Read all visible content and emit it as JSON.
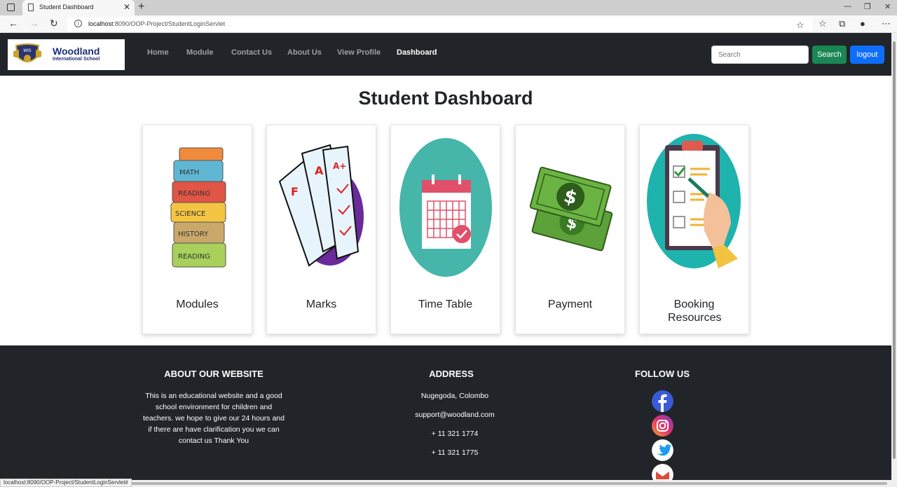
{
  "browser": {
    "tab_title": "Student Dashboard",
    "tab_close": "✕",
    "new_tab": "+",
    "url_host": "localhost",
    "url_rest": ":8090/OOP-Project/StudentLoginServlet",
    "status_url": "localhost:8090/OOP-Project/StudentLoginServlet#"
  },
  "navbar": {
    "logo_name": "Woodland",
    "logo_sub": "International School",
    "logo_badge": "WIS",
    "links": [
      "Home",
      "Module",
      "Contact Us",
      "About Us",
      "View Profile",
      "Dashboard"
    ],
    "active_link": "Dashboard",
    "search_placeholder": "Search",
    "search_button": "Search",
    "logout_button": "logout",
    "colors": {
      "bg": "#212529",
      "search": "#198754",
      "logout": "#0d6efd"
    }
  },
  "main": {
    "heading": "Student Dashboard",
    "cards": [
      {
        "label": "Modules",
        "icon": "books-stack-icon",
        "book_labels": [
          "MATH",
          "READING",
          "SCIENCE",
          "HISTORY",
          "READING"
        ]
      },
      {
        "label": "Marks",
        "icon": "graded-papers-icon",
        "paper_marks": [
          "F",
          "A",
          "A+"
        ]
      },
      {
        "label": "Time Table",
        "icon": "calendar-icon"
      },
      {
        "label": "Payment",
        "icon": "money-icon",
        "currency_symbol": "$"
      },
      {
        "label": "Booking Resources",
        "icon": "clipboard-checklist-icon"
      }
    ]
  },
  "footer": {
    "about_heading": "ABOUT OUR WEBSITE",
    "about_text": "This is an educational website and a good school environment for children and teachers. we hope to give our 24 hours and if there are have clarification you we can contact us Thank You",
    "address_heading": "ADDRESS",
    "address_lines": [
      "Nugegoda, Colombo",
      "support@woodland.com",
      "+ 11 321 1774",
      "+ 11 321 1775"
    ],
    "follow_heading": "FOLLOW US",
    "social": [
      "facebook-icon",
      "instagram-icon",
      "twitter-icon",
      "gmail-icon"
    ]
  }
}
